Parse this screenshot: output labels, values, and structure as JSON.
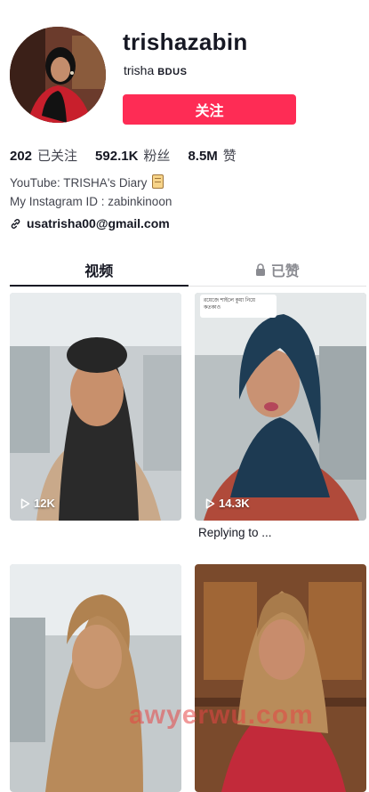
{
  "profile": {
    "username": "trishazabin",
    "nickname": "trisha",
    "nickname_badge": "BDUS",
    "follow_label": "关注",
    "accent_color": "#fe2c55"
  },
  "stats": [
    {
      "value": "202",
      "label": "已关注"
    },
    {
      "value": "592.1K",
      "label": "粉丝"
    },
    {
      "value": "8.5M",
      "label": "赞"
    }
  ],
  "bio": {
    "line1": "YouTube: TRISHA's Diary",
    "line2": "My Instagram ID : zabinkinoon",
    "link": "usatrisha00@gmail.com"
  },
  "tabs": {
    "videos": "视频",
    "liked": "已赞"
  },
  "videos": [
    {
      "views": "12K"
    },
    {
      "views": "14.3K",
      "caption": "Replying to ...",
      "reply_text": "রয়েজে শাইলে কুয়া নিয়ে কতকাও"
    },
    {},
    {}
  ],
  "watermark": "awyerwu.com"
}
